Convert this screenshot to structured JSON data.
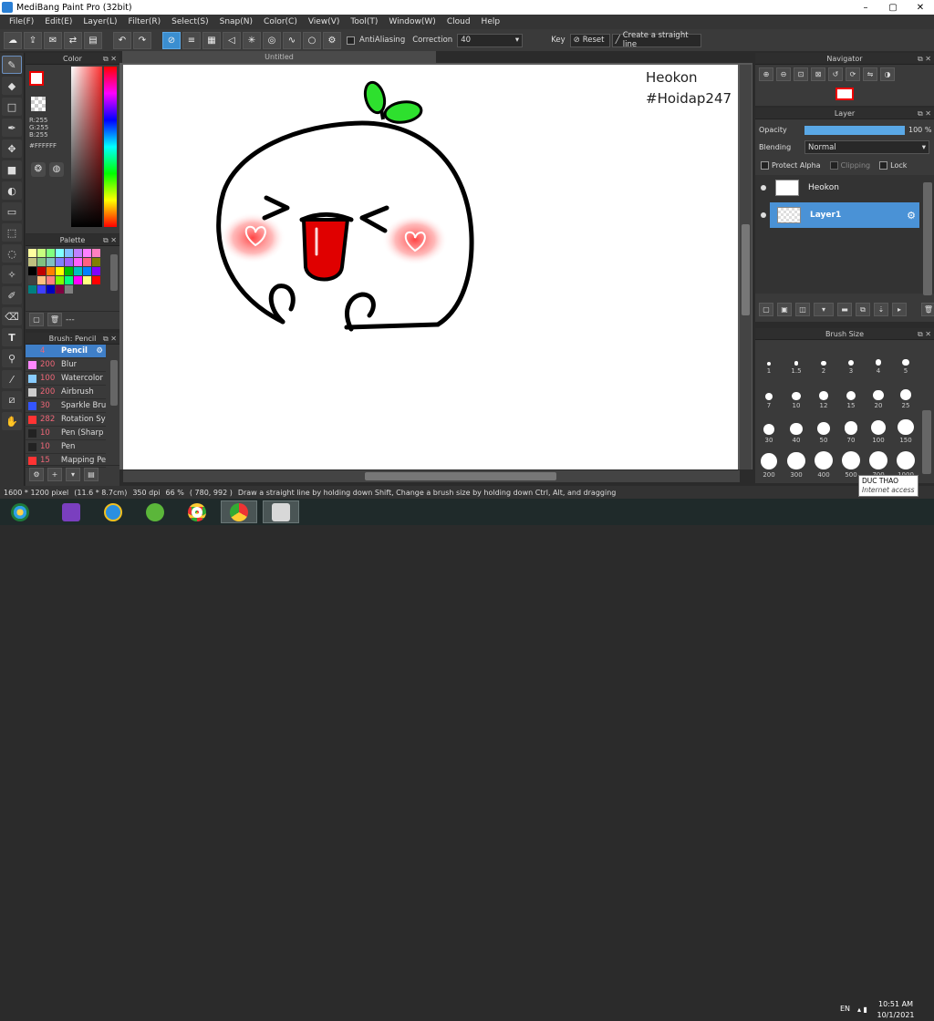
{
  "window": {
    "title": "MediBang Paint Pro (32bit)",
    "controls": [
      "–",
      "▢",
      "✕"
    ]
  },
  "menu": [
    "File(F)",
    "Edit(E)",
    "Layer(L)",
    "Filter(R)",
    "Select(S)",
    "Snap(N)",
    "Color(C)",
    "View(V)",
    "Tool(T)",
    "Window(W)",
    "Cloud",
    "Help"
  ],
  "toolbar": {
    "antialiasing": "AntiAliasing",
    "correction_label": "Correction",
    "correction_value": "40",
    "key_label": "Key",
    "reset_label": "Reset",
    "straight_line_label": "Create a straight line"
  },
  "color_panel": {
    "title": "Color",
    "r": "R:255",
    "g": "G:255",
    "b": "B:255",
    "hex": "#FFFFFF"
  },
  "palette_panel": {
    "title": "Palette",
    "dash": "---",
    "colors": [
      "#ffffa0",
      "#c8ff80",
      "#80ff80",
      "#80ffff",
      "#80c0ff",
      "#c080ff",
      "#ff80ff",
      "#ff80c0",
      "#c0c080",
      "#80c080",
      "#80c0c0",
      "#8080ff",
      "#a060ff",
      "#ff60ff",
      "#ff6080",
      "#808000",
      "#000000",
      "#c00000",
      "#ff8000",
      "#ffff00",
      "#00c000",
      "#00c0c0",
      "#0080ff",
      "#8000ff",
      "#404040",
      "#ffc080",
      "#ff8080",
      "#80ff00",
      "#00ff80",
      "#ff00ff",
      "#ffff80",
      "#ff0000",
      "#008080",
      "#4040ff",
      "#0000c0",
      "#800040",
      "#808080"
    ]
  },
  "brush_panel": {
    "title": "Brush: Pencil",
    "items": [
      {
        "size": "4",
        "name": "Pencil",
        "color": "#3f7fc8"
      },
      {
        "size": "200",
        "name": "Blur",
        "color": "#ff88ff"
      },
      {
        "size": "100",
        "name": "Watercolor",
        "color": "#88ccff"
      },
      {
        "size": "200",
        "name": "Airbrush",
        "color": "#cccccc"
      },
      {
        "size": "30",
        "name": "Sparkle Bru",
        "color": "#3355ff"
      },
      {
        "size": "282",
        "name": "Rotation Sy",
        "color": "#ff3333"
      },
      {
        "size": "10",
        "name": "Pen (Sharp",
        "color": "#222222"
      },
      {
        "size": "10",
        "name": "Pen",
        "color": "#222222"
      },
      {
        "size": "15",
        "name": "Mapping Pe",
        "color": "#ff3333"
      }
    ]
  },
  "document": {
    "tab_title": "Untitled"
  },
  "canvas_text": {
    "line1": "Heokon",
    "line2": "#Hoidap247"
  },
  "navigator": {
    "title": "Navigator"
  },
  "layer_panel": {
    "title": "Layer",
    "opacity_label": "Opacity",
    "opacity_value": "100 %",
    "opacity": 1.0,
    "blending_label": "Blending",
    "blending_value": "Normal",
    "protect_alpha": "Protect Alpha",
    "clipping": "Clipping",
    "lock": "Lock",
    "layers": [
      {
        "name": "Heokon",
        "selected": false
      },
      {
        "name": "Layer1",
        "selected": true
      }
    ]
  },
  "brush_size_panel": {
    "title": "Brush Size",
    "sizes": [
      "1",
      "1.5",
      "2",
      "3",
      "4",
      "5",
      "7",
      "10",
      "12",
      "15",
      "20",
      "25",
      "30",
      "40",
      "50",
      "70",
      "100",
      "150",
      "200",
      "300",
      "400",
      "500",
      "700",
      "1000"
    ]
  },
  "status": {
    "dimensions": "1600 * 1200 pixel",
    "physical": "(11.6 * 8.7cm)",
    "dpi": "350 dpi",
    "zoom": "66 %",
    "coords": "( 780, 992 )",
    "hint": "Draw a straight line by holding down Shift, Change a brush size by holding down Ctrl, Alt, and dragging"
  },
  "tooltip": {
    "title": "DUC THAO",
    "subtitle": "Internet access"
  },
  "tray": {
    "lang": "EN",
    "time": "10:51 AM",
    "date": "10/1/2021"
  }
}
